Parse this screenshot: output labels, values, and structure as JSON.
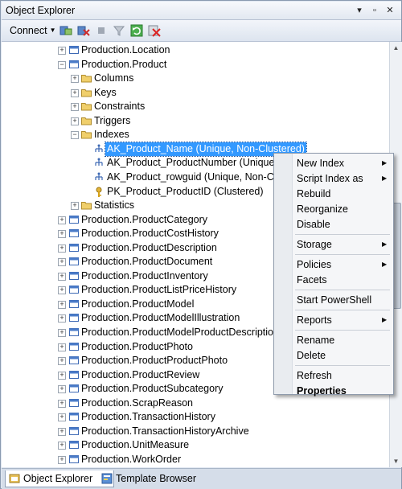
{
  "window": {
    "title": "Object Explorer"
  },
  "title_buttons": [
    {
      "name": "dropdown-icon",
      "glyph": "▾"
    },
    {
      "name": "pin-icon",
      "glyph": "▫"
    },
    {
      "name": "close-icon",
      "glyph": "✕"
    }
  ],
  "toolbar": {
    "connect_label": "Connect",
    "icons": [
      "connect-icon",
      "disconnect-icon",
      "stop-icon",
      "filter-icon",
      "refresh-icon",
      "remove-filter-icon"
    ]
  },
  "tree": {
    "nodes": [
      {
        "label": "Production.Location",
        "level": 0,
        "exp": "+",
        "icon": "table"
      },
      {
        "label": "Production.Product",
        "level": 0,
        "exp": "-",
        "icon": "table"
      },
      {
        "label": "Columns",
        "level": 1,
        "exp": "+",
        "icon": "folder"
      },
      {
        "label": "Keys",
        "level": 1,
        "exp": "+",
        "icon": "folder"
      },
      {
        "label": "Constraints",
        "level": 1,
        "exp": "+",
        "icon": "folder"
      },
      {
        "label": "Triggers",
        "level": 1,
        "exp": "+",
        "icon": "folder"
      },
      {
        "label": "Indexes",
        "level": 1,
        "exp": "-",
        "icon": "folder"
      },
      {
        "label": "AK_Product_Name (Unique, Non-Clustered)",
        "level": 2,
        "exp": "",
        "icon": "index",
        "selected": true
      },
      {
        "label": "AK_Product_ProductNumber (Unique, N",
        "level": 2,
        "exp": "",
        "icon": "index"
      },
      {
        "label": "AK_Product_rowguid (Unique, Non-Clus",
        "level": 2,
        "exp": "",
        "icon": "index"
      },
      {
        "label": "PK_Product_ProductID (Clustered)",
        "level": 2,
        "exp": "",
        "icon": "key"
      },
      {
        "label": "Statistics",
        "level": 1,
        "exp": "+",
        "icon": "folder"
      },
      {
        "label": "Production.ProductCategory",
        "level": 0,
        "exp": "+",
        "icon": "table"
      },
      {
        "label": "Production.ProductCostHistory",
        "level": 0,
        "exp": "+",
        "icon": "table"
      },
      {
        "label": "Production.ProductDescription",
        "level": 0,
        "exp": "+",
        "icon": "table"
      },
      {
        "label": "Production.ProductDocument",
        "level": 0,
        "exp": "+",
        "icon": "table"
      },
      {
        "label": "Production.ProductInventory",
        "level": 0,
        "exp": "+",
        "icon": "table"
      },
      {
        "label": "Production.ProductListPriceHistory",
        "level": 0,
        "exp": "+",
        "icon": "table"
      },
      {
        "label": "Production.ProductModel",
        "level": 0,
        "exp": "+",
        "icon": "table"
      },
      {
        "label": "Production.ProductModelIllustration",
        "level": 0,
        "exp": "+",
        "icon": "table"
      },
      {
        "label": "Production.ProductModelProductDescriptionC",
        "level": 0,
        "exp": "+",
        "icon": "table"
      },
      {
        "label": "Production.ProductPhoto",
        "level": 0,
        "exp": "+",
        "icon": "table"
      },
      {
        "label": "Production.ProductProductPhoto",
        "level": 0,
        "exp": "+",
        "icon": "table"
      },
      {
        "label": "Production.ProductReview",
        "level": 0,
        "exp": "+",
        "icon": "table"
      },
      {
        "label": "Production.ProductSubcategory",
        "level": 0,
        "exp": "+",
        "icon": "table"
      },
      {
        "label": "Production.ScrapReason",
        "level": 0,
        "exp": "+",
        "icon": "table"
      },
      {
        "label": "Production.TransactionHistory",
        "level": 0,
        "exp": "+",
        "icon": "table"
      },
      {
        "label": "Production.TransactionHistoryArchive",
        "level": 0,
        "exp": "+",
        "icon": "table"
      },
      {
        "label": "Production.UnitMeasure",
        "level": 0,
        "exp": "+",
        "icon": "table"
      },
      {
        "label": "Production.WorkOrder",
        "level": 0,
        "exp": "+",
        "icon": "table"
      }
    ]
  },
  "context_menu": {
    "items": [
      {
        "label": "New Index",
        "submenu": true
      },
      {
        "label": "Script Index as",
        "submenu": true
      },
      {
        "label": "Rebuild"
      },
      {
        "label": "Reorganize"
      },
      {
        "label": "Disable"
      },
      {
        "separator": true
      },
      {
        "label": "Storage",
        "submenu": true
      },
      {
        "separator": true
      },
      {
        "label": "Policies",
        "submenu": true
      },
      {
        "label": "Facets"
      },
      {
        "separator": true
      },
      {
        "label": "Start PowerShell"
      },
      {
        "separator": true
      },
      {
        "label": "Reports",
        "submenu": true
      },
      {
        "separator": true
      },
      {
        "label": "Rename"
      },
      {
        "label": "Delete"
      },
      {
        "separator": true
      },
      {
        "label": "Refresh"
      },
      {
        "label": "Properties",
        "bold": true
      }
    ]
  },
  "bottom_tabs": [
    {
      "label": "Object Explorer",
      "active": true
    },
    {
      "label": "Template Browser",
      "active": false
    }
  ],
  "colors": {
    "selection": "#3399ff",
    "folder": "#e8c15a",
    "table_icon": "#4a7bc8",
    "key": "#d4a017"
  }
}
